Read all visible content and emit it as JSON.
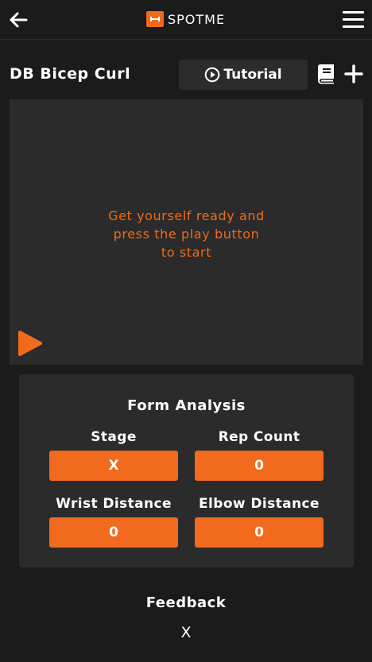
{
  "app": {
    "logo_text": "SPOTME"
  },
  "colors": {
    "accent": "#f26a1d",
    "background": "#1b1b1b",
    "panel": "#2b2b2b"
  },
  "header": {
    "exercise_title": "DB Bicep Curl",
    "tutorial_label": "Tutorial"
  },
  "video": {
    "message_lines": [
      "Get yourself ready and",
      "press the play button",
      "to start"
    ]
  },
  "analysis": {
    "title": "Form Analysis",
    "metrics": [
      {
        "label": "Stage",
        "value": "X"
      },
      {
        "label": "Rep Count",
        "value": "0"
      },
      {
        "label": "Wrist Distance",
        "value": "0"
      },
      {
        "label": "Elbow Distance",
        "value": "0"
      }
    ]
  },
  "feedback": {
    "title": "Feedback",
    "value": "X"
  },
  "icons": [
    "back-arrow-icon",
    "menu-icon",
    "play-circle-icon",
    "book-icon",
    "plus-icon",
    "play-icon"
  ]
}
